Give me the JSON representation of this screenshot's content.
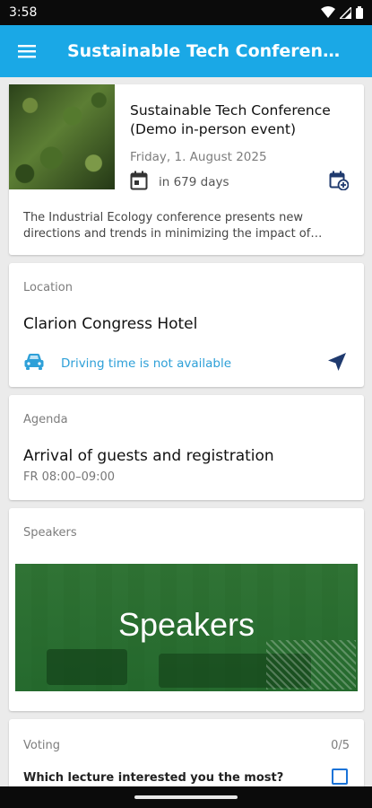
{
  "status_bar": {
    "time": "3:58"
  },
  "app_bar": {
    "title": "Sustainable Tech Conference (Demo in-person event)"
  },
  "event": {
    "title": "Sustainable Tech Conference (Demo in-person event)",
    "date": "Friday, 1. August 2025",
    "countdown": "in 679 days",
    "description": "The Industrial Ecology conference presents new directions and trends in minimizing the impact of industry on the environment."
  },
  "location": {
    "label": "Location",
    "name": "Clarion Congress Hotel",
    "driving_text": "Driving time is not available"
  },
  "agenda": {
    "label": "Agenda",
    "title": "Arrival of guests and registration",
    "time": "FR 08:00–09:00"
  },
  "speakers": {
    "label": "Speakers",
    "banner_text": "Speakers"
  },
  "voting": {
    "label": "Voting",
    "count": "0/5",
    "question": "Which lecture interested you the most?"
  },
  "colors": {
    "app_bar": "#1aa8e6",
    "accent_blue": "#2ea0d8",
    "dark_navy": "#1f3a6e",
    "banner_green": "#2f6f35"
  },
  "icons": {
    "menu": "menu-icon",
    "calendar": "calendar-icon",
    "add_calendar": "add-calendar-icon",
    "car": "car-icon",
    "navigate": "navigate-icon"
  }
}
